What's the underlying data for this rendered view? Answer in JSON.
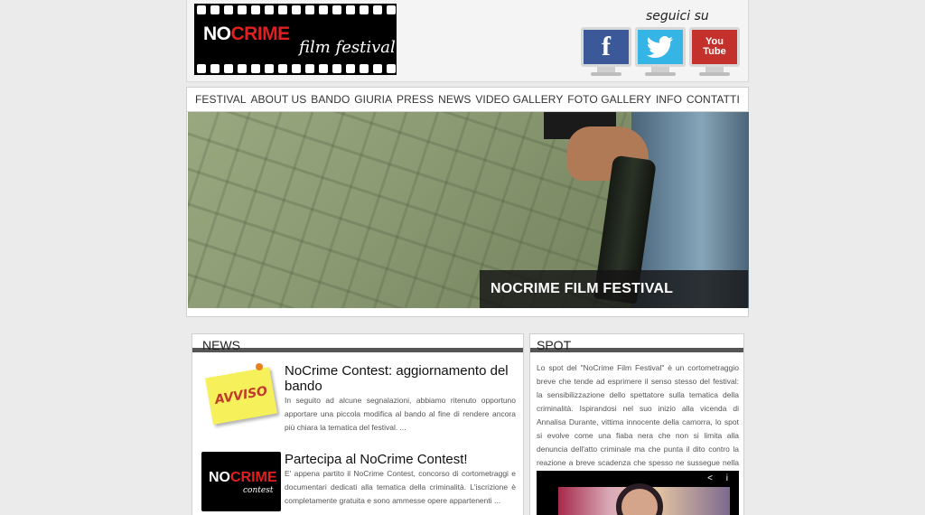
{
  "header": {
    "logo_title_no": "NO",
    "logo_title_crime": "CRIME",
    "logo_subtitle": "film festival",
    "follow_label": "seguici su",
    "social": [
      {
        "name": "facebook",
        "glyph": "f"
      },
      {
        "name": "twitter",
        "glyph": "t"
      },
      {
        "name": "youtube",
        "glyph_top": "You",
        "glyph_bottom": "Tube"
      }
    ]
  },
  "nav": {
    "items": [
      "FESTIVAL",
      "ABOUT US",
      "BANDO",
      "GIURIA",
      "PRESS",
      "NEWS",
      "VIDEO GALLERY",
      "FOTO GALLERY",
      "INFO",
      "CONTATTI"
    ]
  },
  "hero": {
    "caption": "NOCRIME FILM FESTIVAL"
  },
  "news": {
    "title": "NEWS",
    "items": [
      {
        "thumb_label": "AVVISO",
        "title": "NoCrime Contest: aggiornamento del bando",
        "excerpt": "In seguito ad alcune segnalazioni, abbiamo ritenuto opportuno apportare una piccola modifica al bando al fine di rendere ancora più chiara la tematica del festival. ..."
      },
      {
        "thumb_title_no": "NO",
        "thumb_title_crime": "CRIME",
        "thumb_sub": "contest",
        "title": "Partecipa al NoCrime Contest!",
        "excerpt": "E' appena partito il NoCrime Contest, concorso di cortometraggi e documentari dedicati alla tematica della criminalità. L'iscrizione è completamente gratuita e sono ammesse opere appartenenti ..."
      }
    ]
  },
  "spot": {
    "title": "SPOT",
    "text": "Lo spot del \"NoCrime Film Festival\" è un cortometraggio breve che tende ad esprimere il senso stesso del festival: la sensibilizzazione dello spettatore sulla tematica della criminalità. Ispirandosi nel suo inizio alla vicenda di Annalisa Durante, vittima innocente della camorra, lo spot si evolve come una fiaba nera che non si limita alla denuncia dell'atto criminale ma che punta il dito contro la reazione a breve scadenza che spesso ne susseguе nella nostra società.",
    "video_icons": "< i"
  }
}
